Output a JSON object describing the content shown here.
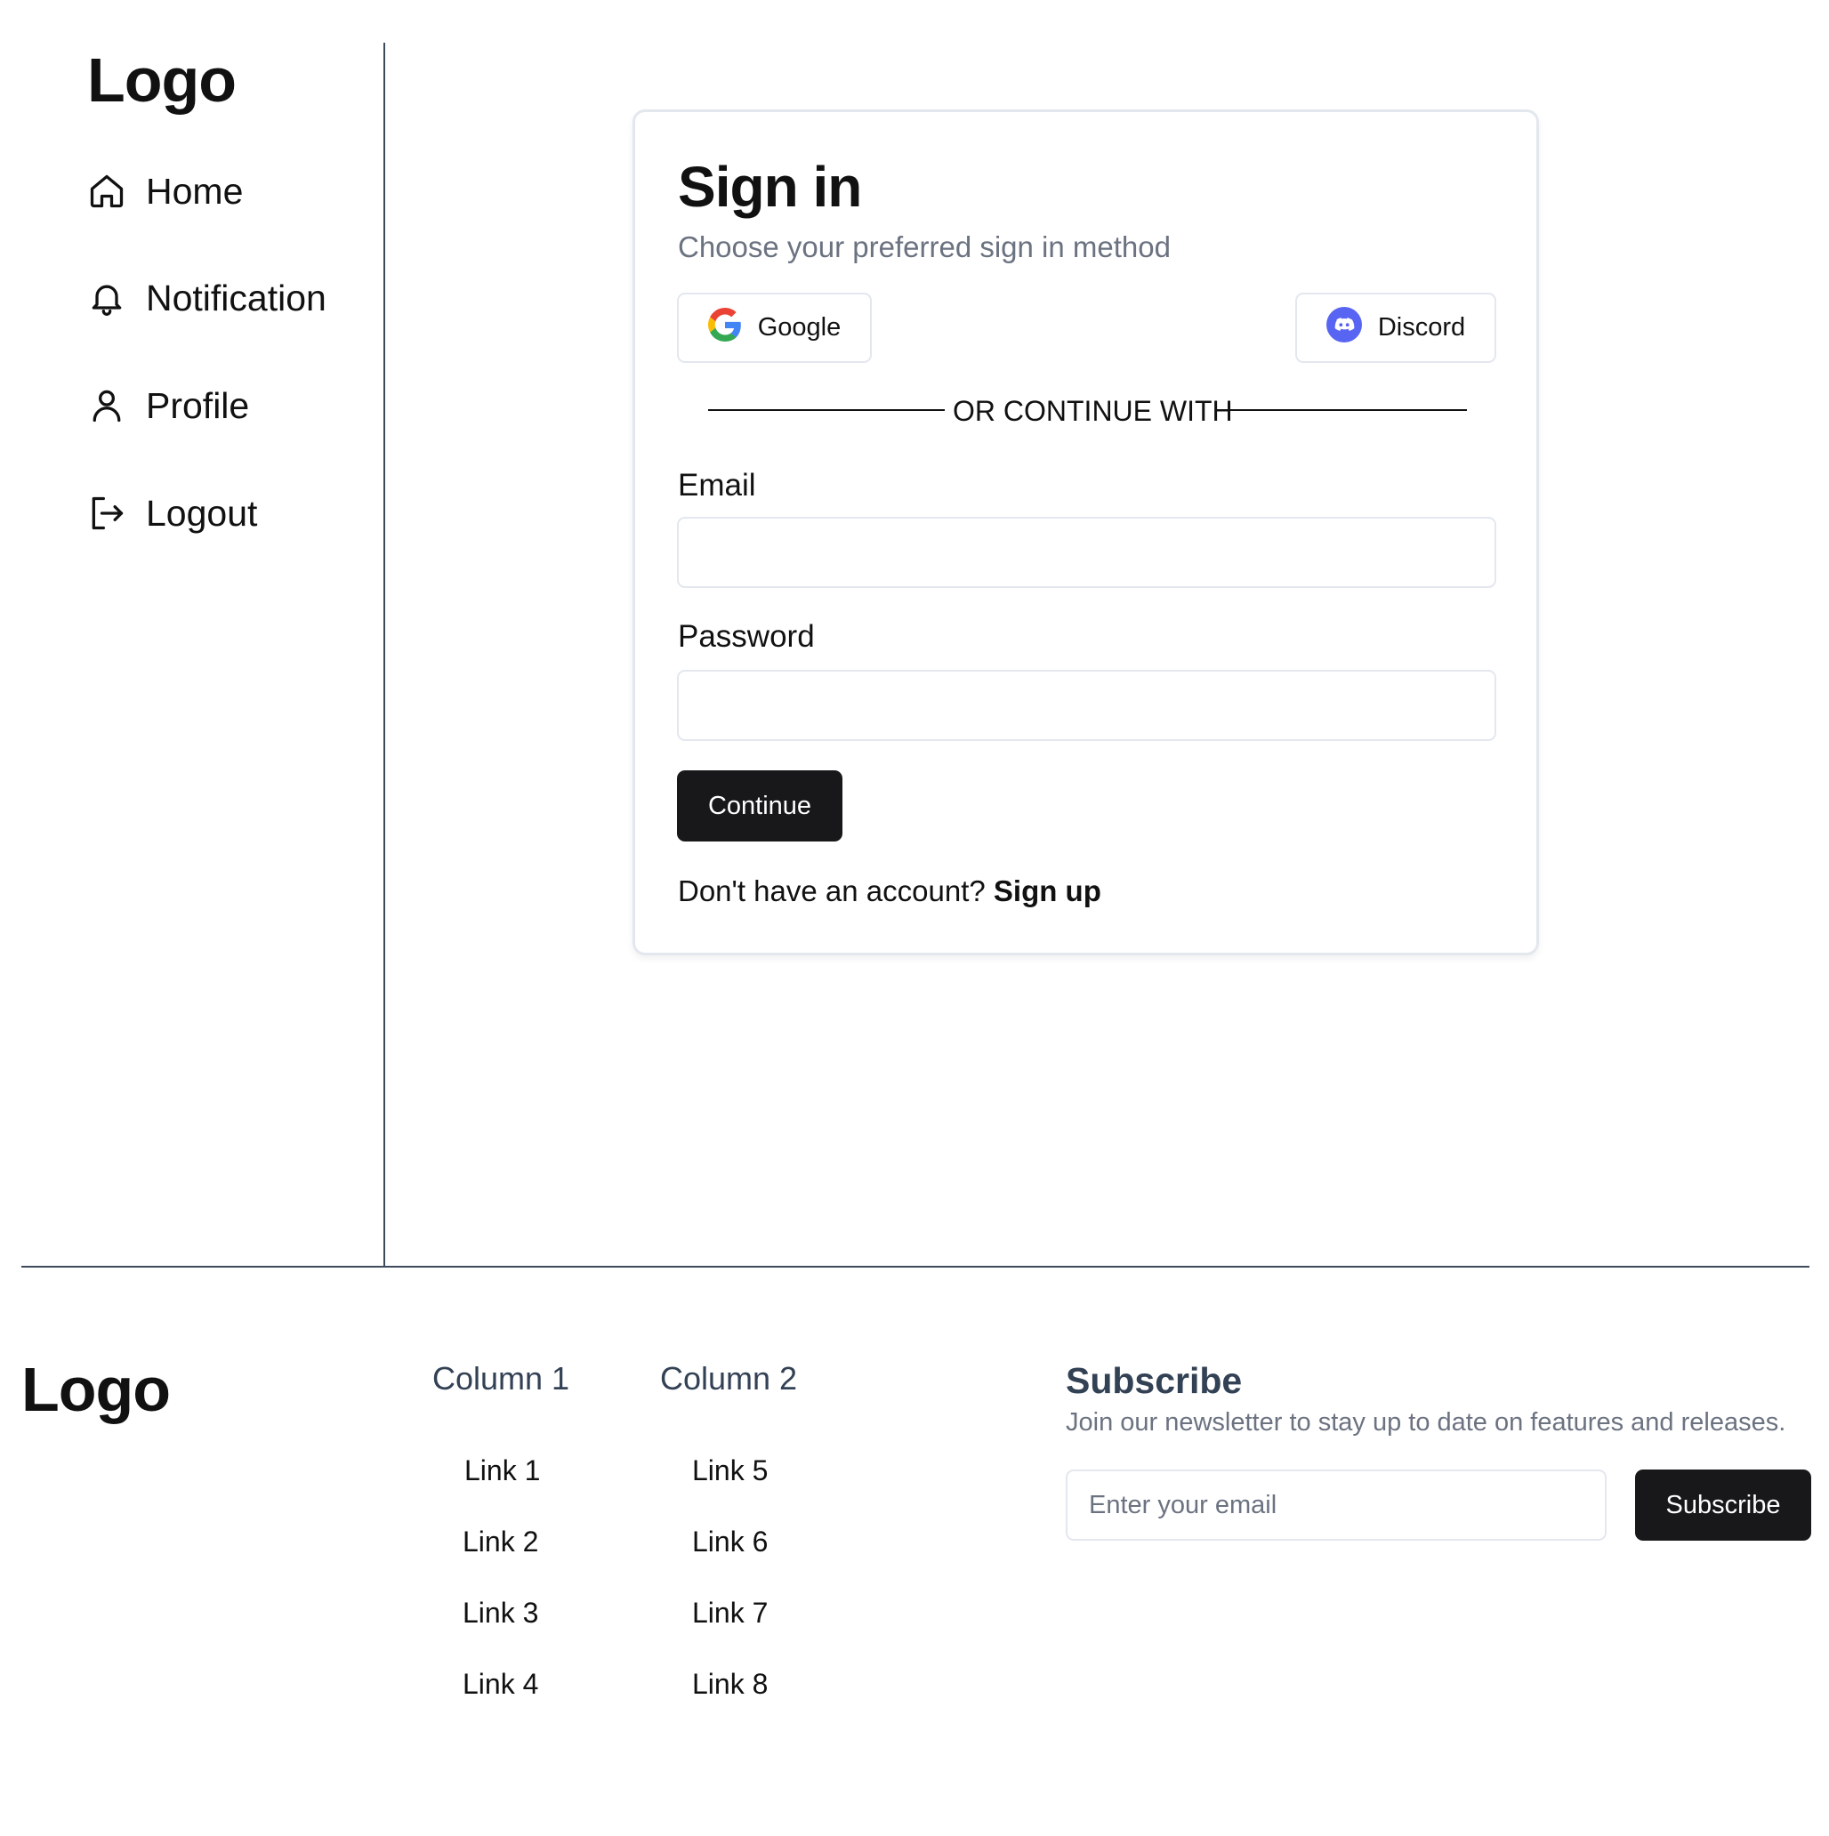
{
  "sidebar": {
    "logo": "Logo",
    "items": [
      {
        "label": "Home",
        "icon": "home-icon"
      },
      {
        "label": "Notification",
        "icon": "bell-icon"
      },
      {
        "label": "Profile",
        "icon": "user-icon"
      },
      {
        "label": "Logout",
        "icon": "logout-icon"
      }
    ]
  },
  "signin": {
    "title": "Sign in",
    "subtitle": "Choose your preferred sign in method",
    "google_label": "Google",
    "discord_label": "Discord",
    "divider_text": "OR CONTINUE WITH",
    "email_label": "Email",
    "email_value": "",
    "password_label": "Password",
    "password_value": "",
    "continue_label": "Continue",
    "signup_prompt": "Don't have an account?",
    "signup_link": "Sign up"
  },
  "footer": {
    "logo": "Logo",
    "columns": [
      {
        "title": "Column 1",
        "links": [
          "Link 1",
          "Link 2",
          "Link 3",
          "Link 4"
        ]
      },
      {
        "title": "Column 2",
        "links": [
          "Link 5",
          "Link 6",
          "Link 7",
          "Link 8"
        ]
      }
    ],
    "subscribe": {
      "title": "Subscribe",
      "text": "Join our newsletter to stay up to date on features and releases.",
      "placeholder": "Enter your email",
      "button": "Subscribe"
    }
  },
  "colors": {
    "primary_button": "#18181b",
    "divider": "#3d4a5c",
    "muted_text": "#6b7280",
    "heading_slate": "#334155",
    "discord": "#5865f2"
  }
}
